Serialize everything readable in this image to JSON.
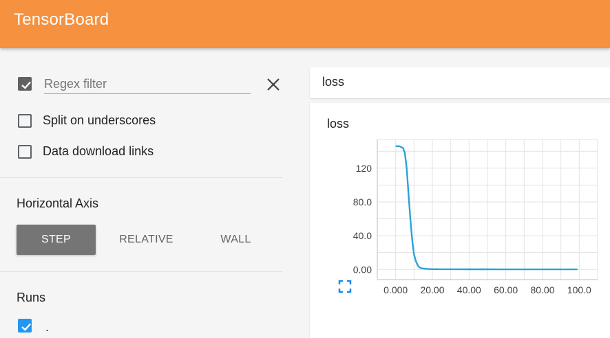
{
  "app": {
    "title": "TensorBoard"
  },
  "sidebar": {
    "regex": {
      "checked": true,
      "placeholder": "Regex filter",
      "value": ""
    },
    "options": [
      {
        "label": "Split on underscores",
        "checked": false
      },
      {
        "label": "Data download links",
        "checked": false
      }
    ],
    "horizontal_axis": {
      "title": "Horizontal Axis",
      "buttons": [
        {
          "label": "STEP",
          "active": true
        },
        {
          "label": "RELATIVE",
          "active": false
        },
        {
          "label": "WALL",
          "active": false
        }
      ]
    },
    "runs": {
      "title": "Runs",
      "items": [
        {
          "label": ".",
          "checked": true
        }
      ]
    }
  },
  "panel": {
    "group_title": "loss",
    "chart_title": "loss"
  },
  "colors": {
    "header": "#f5913f",
    "series": "#29a3d8"
  },
  "chart_data": {
    "type": "line",
    "title": "loss",
    "xlabel": "",
    "ylabel": "",
    "xlim": [
      -10,
      110
    ],
    "ylim": [
      -12,
      154
    ],
    "x_ticks": [
      0,
      20,
      40,
      60,
      80,
      100
    ],
    "x_tick_labels": [
      "0.000",
      "20.00",
      "40.00",
      "60.00",
      "80.00",
      "100.0"
    ],
    "y_ticks": [
      0,
      40,
      80,
      120
    ],
    "y_tick_labels": [
      "0.00",
      "40.0",
      "80.0",
      "120"
    ],
    "grid": true,
    "series": [
      {
        "x": [
          0,
          2,
          4,
          5,
          6,
          7,
          8,
          9,
          10,
          11,
          12,
          13,
          14,
          16,
          18,
          20,
          25,
          30,
          40,
          50,
          60,
          70,
          80,
          90,
          99
        ],
        "y": [
          146,
          146,
          144,
          138,
          120,
          90,
          60,
          35,
          18,
          10,
          5,
          2.5,
          1.5,
          0.8,
          0.5,
          0.4,
          0.3,
          0.25,
          0.2,
          0.18,
          0.15,
          0.13,
          0.12,
          0.11,
          0.1
        ]
      }
    ]
  }
}
